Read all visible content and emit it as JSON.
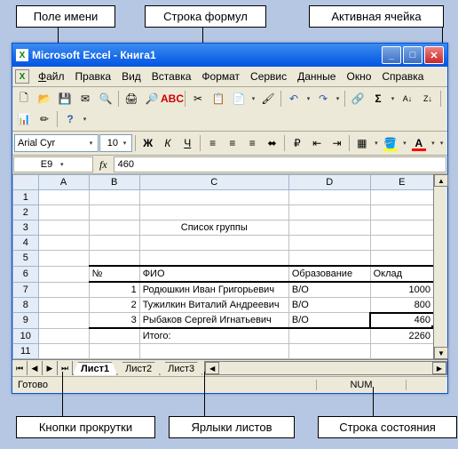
{
  "callouts": {
    "name_box": "Поле имени",
    "formula_bar": "Строка формул",
    "active_cell": "Активная ячейка",
    "scroll_buttons": "Кнопки прокрутки",
    "sheet_tabs": "Ярлыки листов",
    "status_bar": "Строка  состояния"
  },
  "window": {
    "title": "Microsoft Excel - Книга1"
  },
  "menu": {
    "file": "Файл",
    "edit": "Правка",
    "view": "Вид",
    "insert": "Вставка",
    "format": "Формат",
    "tools": "Сервис",
    "data": "Данные",
    "window": "Окно",
    "help": "Справка"
  },
  "toolbar_icons": {
    "new": "new-icon",
    "open": "open-icon",
    "save": "save-icon",
    "mail": "mail-icon",
    "print": "print-icon",
    "preview": "preview-icon",
    "spell": "spell-icon",
    "cut": "cut-icon",
    "copy": "copy-icon",
    "paste": "paste-icon",
    "fmt_paint": "format-painter-icon",
    "undo": "undo-icon",
    "redo": "redo-icon",
    "link": "hyperlink-icon",
    "sum": "autosum-icon",
    "sort_asc": "sort-asc-icon",
    "sort_desc": "sort-desc-icon",
    "chart": "chart-icon",
    "drawing": "drawing-icon",
    "help": "help-icon"
  },
  "format": {
    "font_name": "Arial Cyr",
    "font_size": "10",
    "bold": "Ж",
    "italic": "К",
    "underline": "Ч"
  },
  "formula_bar": {
    "name_box": "E9",
    "fx": "fx",
    "value": "460"
  },
  "columns": [
    "A",
    "B",
    "C",
    "D",
    "E"
  ],
  "rows": [
    "1",
    "2",
    "3",
    "4",
    "5",
    "6",
    "7",
    "8",
    "9",
    "10",
    "11"
  ],
  "sheet": {
    "title": "Список группы",
    "hdr_num": "№",
    "hdr_fio": "ФИО",
    "hdr_edu": "Образование",
    "hdr_salary": "Оклад",
    "r1_num": "1",
    "r1_fio": "Родюшкин Иван Григорьевич",
    "r1_edu": "В/О",
    "r1_sal": "1000",
    "r2_num": "2",
    "r2_fio": "Тужилкин Виталий Андреевич",
    "r2_edu": "В/О",
    "r2_sal": "800",
    "r3_num": "3",
    "r3_fio": "Рыбаков Сергей Игнатьевич",
    "r3_edu": "В/О",
    "r3_sal": "460",
    "total_label": "Итого:",
    "total_val": "2260"
  },
  "tabs": {
    "t1": "Лист1",
    "t2": "Лист2",
    "t3": "Лист3"
  },
  "status": {
    "ready": "Готово",
    "num": "NUM"
  }
}
